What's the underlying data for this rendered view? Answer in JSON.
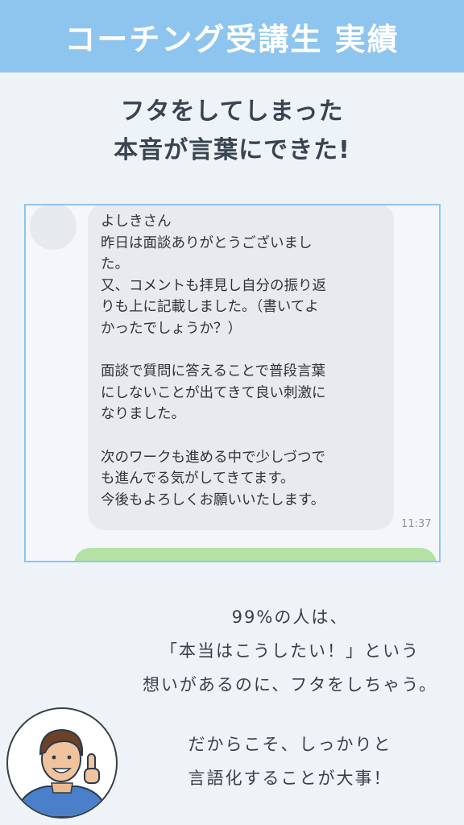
{
  "header": {
    "title": "コーチング受講生 実績"
  },
  "headline": {
    "line1": "フタをしてしまった",
    "line2": "本音が言葉にできた!"
  },
  "chat": {
    "message_lines": [
      "よしきさん",
      "昨日は面談ありがとうございまし",
      "た。",
      "又、コメントも拝見し自分の振り返",
      "りも上に記載しました。（書いてよ",
      "かったでしょうか？）",
      "",
      "面談で質問に答えることで普段言葉",
      "にしないことが出てきて良い刺激に",
      "なりました。",
      "",
      "次のワークも進める中で少しづつで",
      "も進んでる気がしてきてます。",
      "今後もよろしくお願いいたします。"
    ],
    "timestamp": "11:37"
  },
  "handwritten": {
    "line1": "99%の人は、",
    "line2": "「本当はこうしたい！」という",
    "line3": "想いがあるのに、フタをしちゃう。",
    "line4": "だからこそ、しっかりと",
    "line5": "言語化することが大事！"
  },
  "colors": {
    "header_bg": "#8ec5ee",
    "frame_border": "#8ec5ee",
    "reply_bubble": "#b5e2a4",
    "page_bg": "#eef3f8"
  }
}
